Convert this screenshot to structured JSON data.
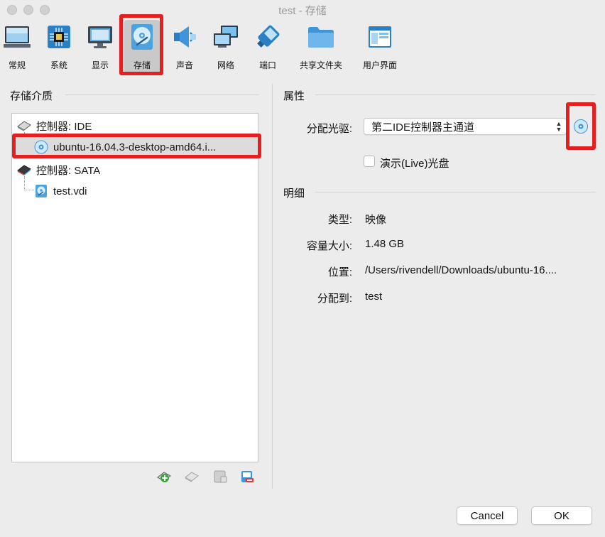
{
  "window": {
    "title": "test - 存储"
  },
  "toolbar": {
    "items": [
      {
        "label": "常规",
        "icon": "general-icon"
      },
      {
        "label": "系统",
        "icon": "system-icon"
      },
      {
        "label": "显示",
        "icon": "display-icon"
      },
      {
        "label": "存储",
        "icon": "storage-icon",
        "selected": true
      },
      {
        "label": "声音",
        "icon": "audio-icon"
      },
      {
        "label": "网络",
        "icon": "network-icon"
      },
      {
        "label": "端口",
        "icon": "ports-icon"
      },
      {
        "label": "共享文件夹",
        "icon": "shared-folder-icon"
      },
      {
        "label": "用户界面",
        "icon": "user-interface-icon"
      }
    ]
  },
  "storage": {
    "title": "存储介质",
    "tree": [
      {
        "label": "控制器: IDE",
        "type": "controller"
      },
      {
        "label": "ubuntu-16.04.3-desktop-amd64.i...",
        "type": "optical",
        "selected": true
      },
      {
        "label": "控制器: SATA",
        "type": "controller"
      },
      {
        "label": "test.vdi",
        "type": "disk"
      }
    ]
  },
  "attributes": {
    "title": "属性",
    "drive_label": "分配光驱:",
    "drive_value": "第二IDE控制器主通道",
    "live_cd_label": "演示(Live)光盘"
  },
  "details": {
    "title": "明细",
    "type_label": "类型:",
    "type_value": "映像",
    "size_label": "容量大小:",
    "size_value": "1.48 GB",
    "location_label": "位置:",
    "location_value": "/Users/rivendell/Downloads/ubuntu-16....",
    "attached_label": "分配到:",
    "attached_value": "test"
  },
  "buttons": {
    "cancel": "Cancel",
    "ok": "OK"
  },
  "colors": {
    "highlight": "#e31f1f",
    "accent": "#2a8fd6"
  }
}
